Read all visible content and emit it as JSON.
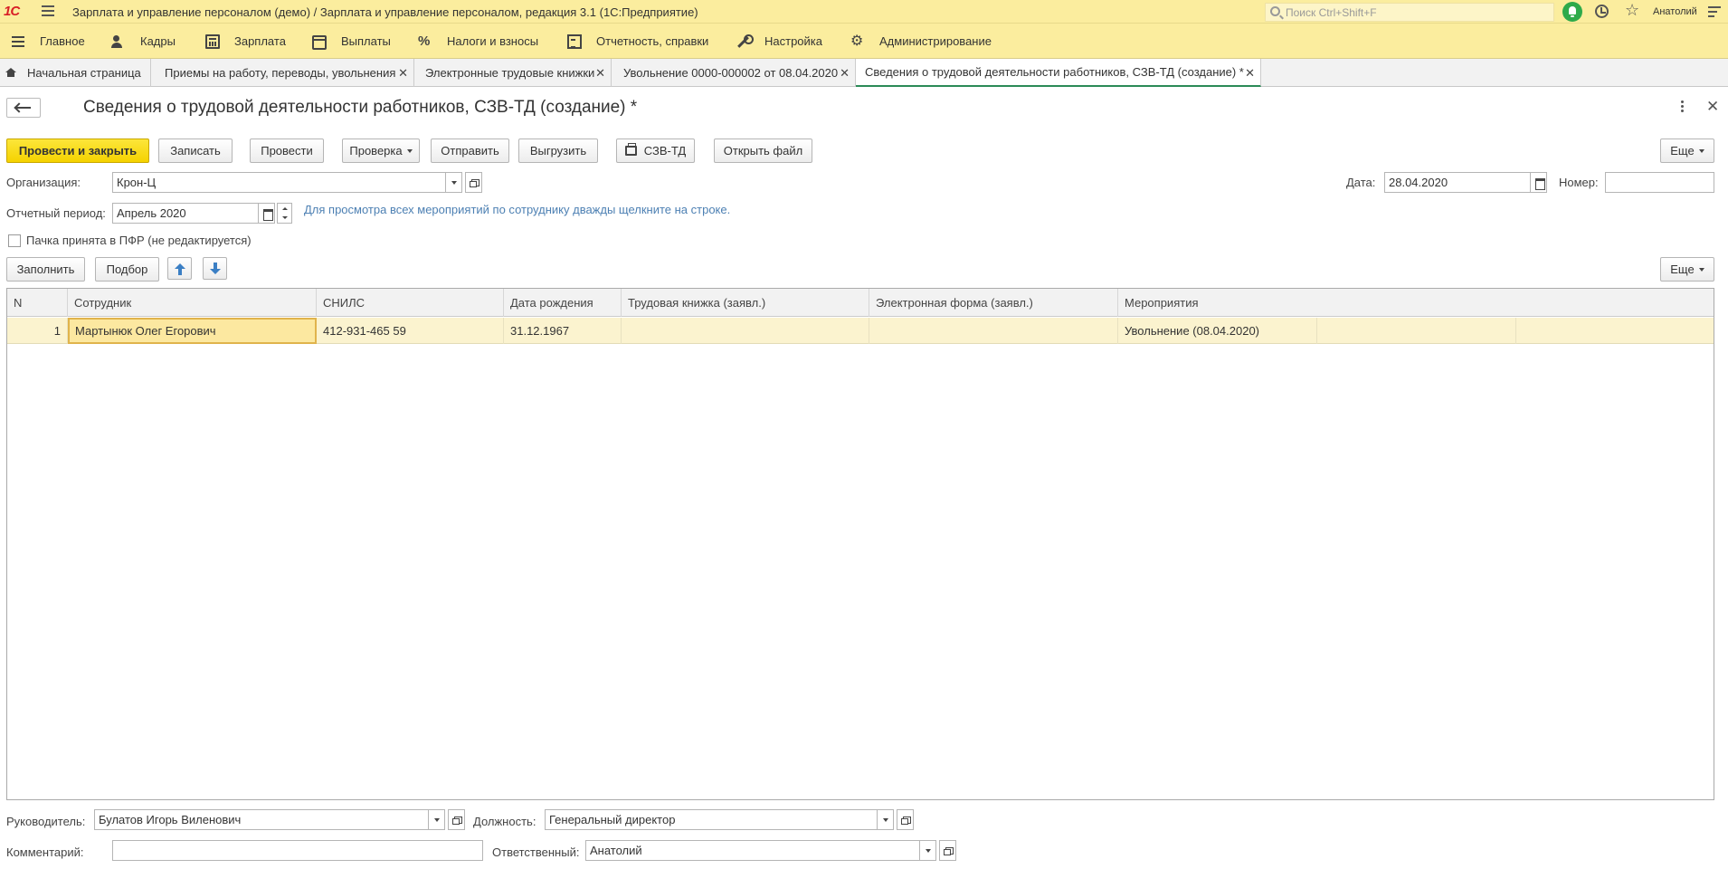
{
  "app": {
    "logo": "1С",
    "window_title": "Зарплата и управление персоналом (демо) / Зарплата и управление персоналом, редакция 3.1  (1С:Предприятие)",
    "search_placeholder": "Поиск Ctrl+Shift+F",
    "user_name": "Анатолий"
  },
  "sections": [
    {
      "label": "Главное",
      "icon": "menu-icon"
    },
    {
      "label": "Кадры",
      "icon": "people-icon"
    },
    {
      "label": "Зарплата",
      "icon": "calculator-icon"
    },
    {
      "label": "Выплаты",
      "icon": "wallet-icon"
    },
    {
      "label": "Налоги и взносы",
      "icon": "percent-icon"
    },
    {
      "label": "Отчетность, справки",
      "icon": "documents-icon"
    },
    {
      "label": "Настройка",
      "icon": "wrench-icon"
    },
    {
      "label": "Администрирование",
      "icon": "gear-icon"
    }
  ],
  "tabs": [
    {
      "label": "Начальная страница",
      "active": false
    },
    {
      "label": "Приемы на работу, переводы, увольнения",
      "active": false
    },
    {
      "label": "Электронные трудовые книжки",
      "active": false
    },
    {
      "label": "Увольнение 0000-000002 от 08.04.2020",
      "active": false
    },
    {
      "label": "Сведения о трудовой деятельности работников, СЗВ-ТД (создание) *",
      "active": true
    }
  ],
  "form": {
    "title": "Сведения о трудовой деятельности работников, СЗВ-ТД (создание) *",
    "toolbar": {
      "post_close": "Провести и закрыть",
      "save": "Записать",
      "post": "Провести",
      "check": "Проверка",
      "send": "Отправить",
      "export": "Выгрузить",
      "print": "СЗВ-ТД",
      "open_file": "Открыть файл",
      "more": "Еще"
    },
    "organization": {
      "label": "Организация:",
      "value": "Крон-Ц"
    },
    "date": {
      "label": "Дата:",
      "value": "28.04.2020"
    },
    "number": {
      "label": "Номер:",
      "value": ""
    },
    "period": {
      "label": "Отчетный период:",
      "value": "Апрель 2020"
    },
    "hint": "Для просмотра всех мероприятий по сотруднику дважды щелкните на строке.",
    "pfr_checkbox": {
      "label": "Пачка принята в ПФР (не редактируется)",
      "checked": false
    },
    "table_toolbar": {
      "fill": "Заполнить",
      "pick": "Подбор",
      "more": "Еще"
    },
    "table": {
      "columns": [
        "N",
        "Сотрудник",
        "СНИЛС",
        "Дата рождения",
        "Трудовая книжка (заявл.)",
        "Электронная форма (заявл.)",
        "Мероприятия"
      ],
      "rows": [
        {
          "n": "1",
          "employee": "Мартынюк Олег Егорович",
          "snils": "412-931-465 59",
          "birth_date": "31.12.1967",
          "paper_book": "",
          "electronic_form": "",
          "events": "Увольнение (08.04.2020)"
        }
      ]
    },
    "head": {
      "label": "Руководитель:",
      "value": "Булатов Игорь Виленович"
    },
    "position": {
      "label": "Должность:",
      "value": "Генеральный директор"
    },
    "comment": {
      "label": "Комментарий:",
      "value": ""
    },
    "responsible": {
      "label": "Ответственный:",
      "value": "Анатолий"
    }
  },
  "colors": {
    "header_bg": "#fbed9e",
    "primary_button": "#f5d200",
    "hint_link": "#4d80b3",
    "selected_row": "#fbf3cf",
    "active_tab_underline": "#2b8a57"
  }
}
